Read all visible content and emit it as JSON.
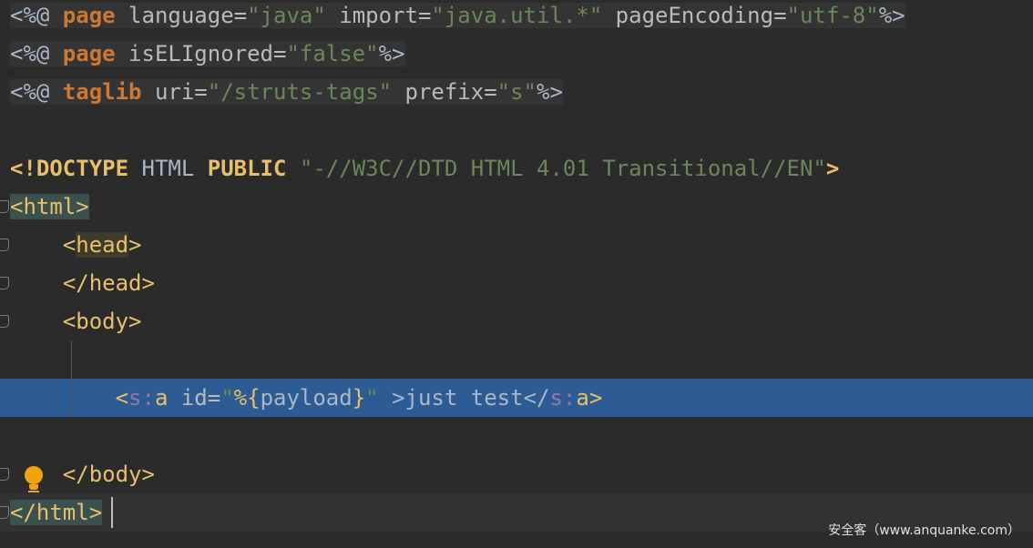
{
  "editor": {
    "lines": [
      {
        "segments": [
          {
            "text": "<%@ ",
            "class": "p dir-bg"
          },
          {
            "text": "page",
            "class": "k dir-bg"
          },
          {
            "text": " language=",
            "class": "a dir-bg"
          },
          {
            "text": "\"java\"",
            "class": "s dir-bg"
          },
          {
            "text": " import=",
            "class": "a dir-bg"
          },
          {
            "text": "\"java.util.*\"",
            "class": "s dir-bg"
          },
          {
            "text": " pageEncoding=",
            "class": "a dir-bg"
          },
          {
            "text": "\"utf-8\"",
            "class": "s dir-bg"
          },
          {
            "text": "%>",
            "class": "p dir-bg"
          }
        ]
      },
      {
        "segments": [
          {
            "text": "<%@ ",
            "class": "p dir-bg"
          },
          {
            "text": "page",
            "class": "k dir-bg"
          },
          {
            "text": " isELIgnored=",
            "class": "a dir-bg"
          },
          {
            "text": "\"false\"",
            "class": "s dir-bg"
          },
          {
            "text": "%>",
            "class": "p dir-bg"
          }
        ]
      },
      {
        "segments": [
          {
            "text": "<%@ ",
            "class": "p dir-bg"
          },
          {
            "text": "taglib",
            "class": "k dir-bg"
          },
          {
            "text": " uri=",
            "class": "a dir-bg"
          },
          {
            "text": "\"/struts-tags\"",
            "class": "s dir-bg"
          },
          {
            "text": " prefix=",
            "class": "a dir-bg"
          },
          {
            "text": "\"s\"",
            "class": "s dir-bg"
          },
          {
            "text": "%>",
            "class": "p dir-bg"
          }
        ]
      },
      {
        "segments": []
      },
      {
        "segments": [
          {
            "text": "<!DOCTYPE ",
            "class": "tb"
          },
          {
            "text": "HTML ",
            "class": "p"
          },
          {
            "text": "PUBLIC ",
            "class": "tb"
          },
          {
            "text": "\"-//W3C//DTD HTML 4.01 Transitional//EN\"",
            "class": "s"
          },
          {
            "text": ">",
            "class": "tb"
          }
        ]
      },
      {
        "segments": [
          {
            "text": "<html>",
            "class": "t hl-tag"
          }
        ]
      },
      {
        "segments": [
          {
            "text": "    <",
            "class": "t"
          },
          {
            "text": "head",
            "class": "t hl-head"
          },
          {
            "text": ">",
            "class": "t"
          }
        ]
      },
      {
        "segments": [
          {
            "text": "    </head>",
            "class": "t"
          }
        ]
      },
      {
        "segments": [
          {
            "text": "    <body>",
            "class": "t"
          }
        ]
      },
      {
        "segments": []
      },
      {
        "segments": [
          {
            "text": "        <",
            "class": "t"
          },
          {
            "text": "s:",
            "class": "ns"
          },
          {
            "text": "a",
            "class": "t"
          },
          {
            "text": " id=",
            "class": "a"
          },
          {
            "text": "\"",
            "class": "s"
          },
          {
            "text": "%{",
            "class": "ex"
          },
          {
            "text": "payload",
            "class": "p"
          },
          {
            "text": "}",
            "class": "ex"
          },
          {
            "text": "\"",
            "class": "s"
          },
          {
            "text": " >just test</",
            "class": "p"
          },
          {
            "text": "s:",
            "class": "ns"
          },
          {
            "text": "a",
            "class": "t"
          },
          {
            "text": ">",
            "class": "t"
          }
        ]
      },
      {
        "segments": []
      },
      {
        "segments": [
          {
            "text": "    </body>",
            "class": "t"
          }
        ]
      },
      {
        "segments": [
          {
            "text": "</html>",
            "class": "t hl-tag"
          }
        ]
      }
    ]
  },
  "watermark": "安全客（www.anquanke.com）",
  "icons": {
    "intention": "lightbulb-icon",
    "fold": "fold-marker-icon"
  },
  "colors": {
    "background": "#2b2b2b",
    "selection": "#2d5c94",
    "keyword": "#cc7832",
    "string": "#6a8759",
    "tag": "#e8bf6a"
  }
}
